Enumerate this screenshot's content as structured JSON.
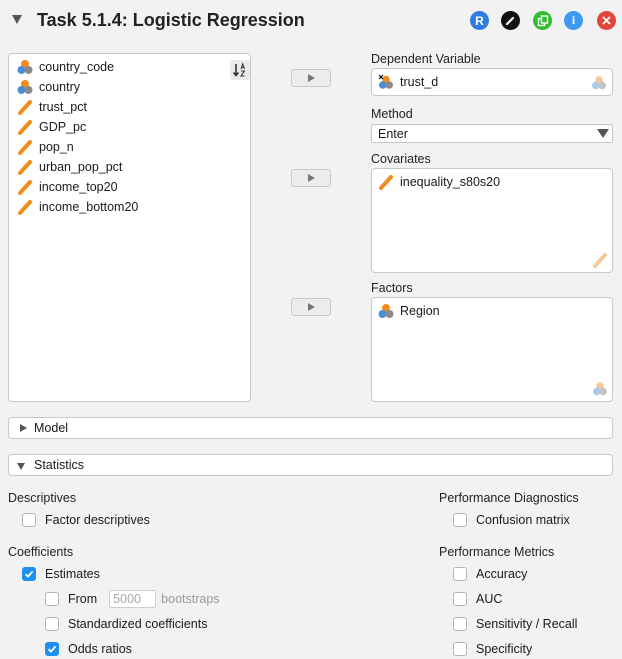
{
  "header": {
    "title": "Task 5.1.4: Logistic Regression",
    "r_label": "R",
    "info_label": "i",
    "colors": {
      "r": "#2e7de0",
      "edit": "#111111",
      "dup": "#2fbf2f",
      "info": "#3d9af0",
      "close": "#e0483d"
    }
  },
  "variables": [
    {
      "label": "country_code",
      "icon": "nominal-text-icon"
    },
    {
      "label": "country",
      "icon": "nominal-text-icon"
    },
    {
      "label": "trust_pct",
      "icon": "scale-icon"
    },
    {
      "label": "GDP_pc",
      "icon": "scale-icon"
    },
    {
      "label": "pop_n",
      "icon": "scale-icon"
    },
    {
      "label": "urban_pop_pct",
      "icon": "scale-icon"
    },
    {
      "label": "income_top20",
      "icon": "scale-icon"
    },
    {
      "label": "income_bottom20",
      "icon": "scale-icon"
    }
  ],
  "dependent": {
    "label": "Dependent Variable",
    "value": "trust_d"
  },
  "method": {
    "label": "Method",
    "value": "Enter"
  },
  "covariates": {
    "label": "Covariates",
    "items": [
      "inequality_s80s20"
    ]
  },
  "factors": {
    "label": "Factors",
    "items": [
      "Region"
    ]
  },
  "sections": {
    "model": "Model",
    "statistics": "Statistics"
  },
  "statistics": {
    "descriptives": {
      "title": "Descriptives",
      "factor_descriptives": "Factor descriptives"
    },
    "coefficients": {
      "title": "Coefficients",
      "estimates": "Estimates",
      "from": "From",
      "bootstraps_value": "5000",
      "bootstraps": "bootstraps",
      "standardized": "Standardized coefficients",
      "odds_ratios": "Odds ratios"
    },
    "perf_diag": {
      "title": "Performance Diagnostics",
      "confusion": "Confusion matrix"
    },
    "perf_metrics": {
      "title": "Performance Metrics",
      "accuracy": "Accuracy",
      "auc": "AUC",
      "sens": "Sensitivity / Recall",
      "spec": "Specificity"
    }
  },
  "checked": {
    "factor_descriptives": false,
    "estimates": true,
    "from": false,
    "standardized": false,
    "odds_ratios": true,
    "confusion": false,
    "accuracy": false,
    "auc": false,
    "sens": false,
    "spec": false
  },
  "icon_colors": {
    "scale": "#f28c1e",
    "nominal_orange": "#f28c1e",
    "nominal_blue": "#4a8ed8",
    "nominal_grey": "#8a8a8a"
  }
}
